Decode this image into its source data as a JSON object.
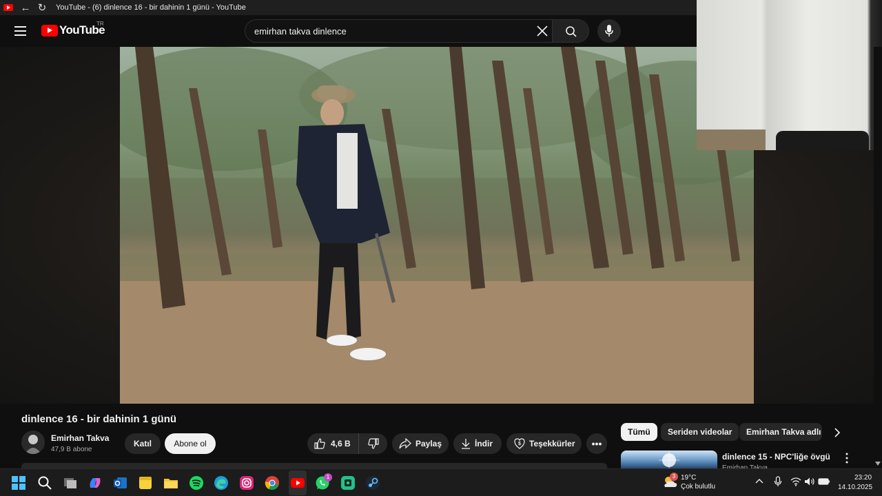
{
  "window": {
    "title": "YouTube - (6) dinlence 16 - bir dahinin 1 günü - YouTube"
  },
  "masthead": {
    "logo_text": "YouTube",
    "country_code": "TR",
    "search_value": "emirhan takva dinlence"
  },
  "video": {
    "title": "dinlence 16 - bir dahinin 1 günü",
    "channel_name": "Emirhan Takva",
    "subscribers": "47,9 B abone",
    "join_label": "Katıl",
    "subscribe_label": "Abone ol",
    "likes": "4,6 B",
    "share_label": "Paylaş",
    "download_label": "İndir",
    "thanks_label": "Teşekkürler",
    "more_label": "•••"
  },
  "chips": [
    {
      "label": "Tümü",
      "active": true
    },
    {
      "label": "Seriden videolar",
      "active": false
    },
    {
      "label": "Emirhan Takva adlı y",
      "active": false
    }
  ],
  "recommended": [
    {
      "title": "dinlence 15 - NPC'liğe övgü",
      "channel": "Emirhan Takva"
    }
  ],
  "taskbar": {
    "apps": [
      "windows-start",
      "search",
      "task-view",
      "copilot",
      "outlook",
      "sticky-notes",
      "file-explorer",
      "spotify",
      "edge",
      "instagram",
      "chrome",
      "youtube",
      "whatsapp",
      "wplace",
      "steam"
    ],
    "whatsapp_badge": "1",
    "weather_badge": "3",
    "weather_temp": "19°C",
    "weather_desc": "Çok bulutlu",
    "time": "23:20",
    "date": "14.10.2025"
  },
  "colors": {
    "brand_red": "#ff0000",
    "background": "#0f0f0f",
    "chip_bg": "#272727"
  }
}
